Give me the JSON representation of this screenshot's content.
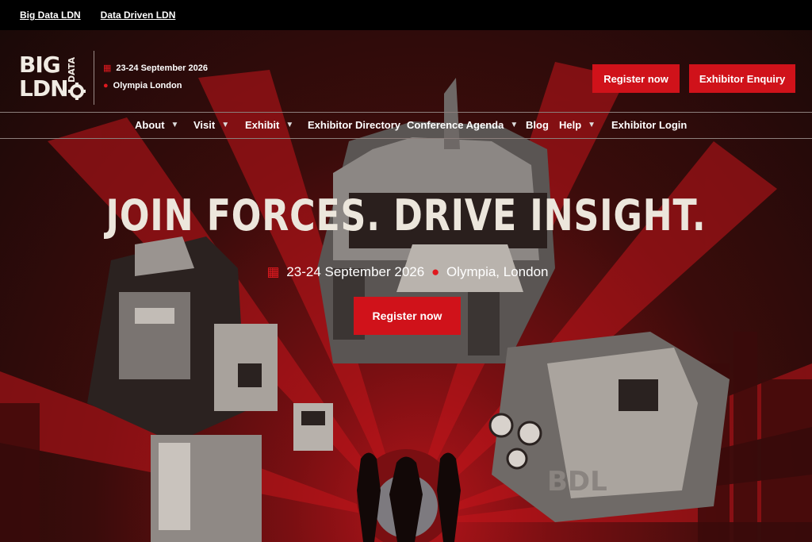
{
  "topbar": {
    "links": [
      "Big Data LDN",
      "Data Driven LDN"
    ]
  },
  "logo": {
    "line1": "BIG",
    "line2": "LDN",
    "vertical": "DATA"
  },
  "event": {
    "date": "23-24 September 2026",
    "location_short": "Olympia London",
    "location_long": "Olympia, London"
  },
  "header_buttons": {
    "register": "Register now",
    "exhibitor_enquiry": "Exhibitor Enquiry"
  },
  "nav": {
    "items": [
      {
        "label": "About",
        "dropdown": true
      },
      {
        "label": "Visit",
        "dropdown": true
      },
      {
        "label": "Exhibit",
        "dropdown": true
      },
      {
        "label": "Exhibitor Directory",
        "dropdown": false
      },
      {
        "label": "Conference Agenda",
        "dropdown": true
      },
      {
        "label": "Blog",
        "dropdown": false
      },
      {
        "label": "Help",
        "dropdown": true
      },
      {
        "label": "Exhibitor Login",
        "dropdown": false
      }
    ]
  },
  "hero": {
    "headline": "JOIN FORCES. DRIVE INSIGHT.",
    "register": "Register now",
    "art_label": "BDL"
  },
  "colors": {
    "accent": "#d0121a",
    "topbar": "#000000",
    "headline": "#ece6dc"
  },
  "icons": {
    "calendar": "calendar-icon",
    "location": "map-pin-icon",
    "dropdown": "chevron-down-icon"
  }
}
